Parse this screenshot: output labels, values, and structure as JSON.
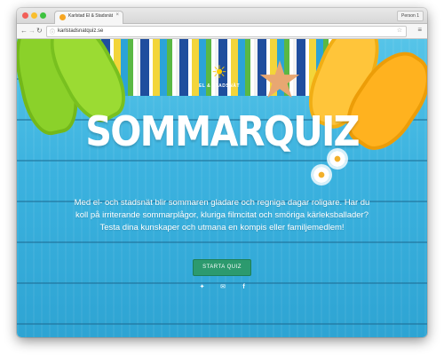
{
  "browser": {
    "tab_title": "Karlstad El & Stadsnät",
    "tab_close": "×",
    "profile": "Person 1",
    "url": "karlstadsnatquiz.se",
    "icons": {
      "back": "back-arrow-icon",
      "forward": "forward-arrow-icon",
      "reload": "reload-icon",
      "info": "info-icon",
      "bookmark": "star-icon",
      "menu": "menu-icon"
    }
  },
  "hero": {
    "logo_text": "EL & STADSNÄT",
    "title": "SOMMARQUIZ",
    "intro": "Med el- och stadsnät blir sommaren gladare och regniga dagar roligare. Har du koll på irriterande sommarplågor, kluriga filmcitat och smöriga kärleksballader? Testa dina kunskaper och utmana en kompis eller familjemedlem!",
    "start_label": "STARTA QUIZ",
    "social": [
      "twitter-icon",
      "mail-icon",
      "facebook-icon"
    ]
  },
  "colors": {
    "sky_blue": "#3bb2df",
    "button_green": "#2c9a6e",
    "flipflop_green": "#8bd12a",
    "flipflop_yellow": "#ffc53a"
  }
}
